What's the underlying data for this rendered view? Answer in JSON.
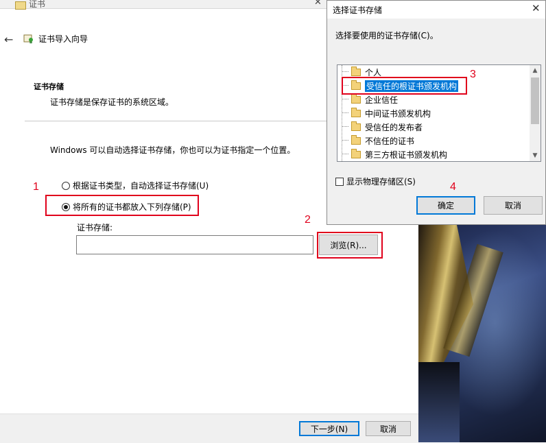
{
  "wizard": {
    "window_title": "证书",
    "title": "证书导入向导",
    "section_title": "证书存储",
    "section_desc": "证书存储是保存证书的系统区域。",
    "info": "Windows 可以自动选择证书存储，你也可以为证书指定一个位置。",
    "radio_auto": "根据证书类型，自动选择证书存储(U)",
    "radio_manual": "将所有的证书都放入下列存储(P)",
    "store_label": "证书存储:",
    "store_value": "",
    "browse": "浏览(R)...",
    "next": "下一步(N)",
    "cancel": "取消"
  },
  "dialog": {
    "title": "选择证书存储",
    "prompt": "选择要使用的证书存储(C)。",
    "stores": [
      "个人",
      "受信任的根证书颁发机构",
      "企业信任",
      "中间证书颁发机构",
      "受信任的发布者",
      "不信任的证书",
      "第三方根证书颁发机构"
    ],
    "selected_index": 1,
    "show_physical": "显示物理存储区(S)",
    "ok": "确定",
    "cancel": "取消"
  },
  "annotations": [
    "1",
    "2",
    "3",
    "4"
  ],
  "colors": {
    "annotation": "#e0001b",
    "selection": "#0078d7"
  }
}
